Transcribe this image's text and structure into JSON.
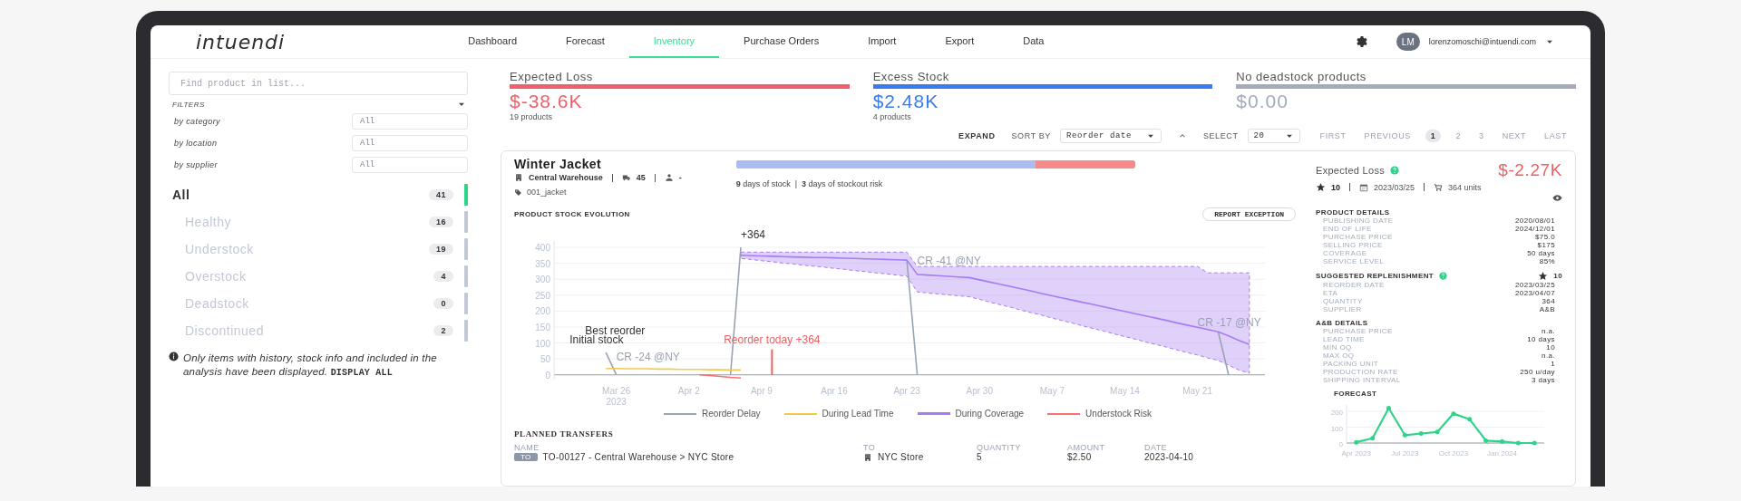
{
  "header": {
    "logo": "intuendi",
    "tabs": [
      {
        "label": "Dashboard",
        "selected": false
      },
      {
        "label": "Forecast",
        "selected": false
      },
      {
        "label": "Inventory",
        "selected": true
      },
      {
        "label": "Purchase Orders",
        "selected": false
      },
      {
        "label": "Import",
        "selected": false
      },
      {
        "label": "Export",
        "selected": false
      },
      {
        "label": "Data",
        "selected": false
      }
    ],
    "user": {
      "initials": "LM",
      "email": "lorenzomoschi@intuendi.com"
    }
  },
  "sidebar": {
    "search": {
      "placeholder": "Find product in list..."
    },
    "filters_label": "FILTERS",
    "filters": [
      {
        "label": "by category",
        "value": "All"
      },
      {
        "label": "by location",
        "value": "All"
      },
      {
        "label": "by supplier",
        "value": "All"
      }
    ],
    "categories": [
      {
        "label": "All",
        "count": "41",
        "selected": true
      },
      {
        "label": "Healthy",
        "count": "16",
        "selected": false
      },
      {
        "label": "Understock",
        "count": "19",
        "selected": false
      },
      {
        "label": "Overstock",
        "count": "4",
        "selected": false
      },
      {
        "label": "Deadstock",
        "count": "0",
        "selected": false
      },
      {
        "label": "Discontinued",
        "count": "2",
        "selected": false
      }
    ],
    "note": {
      "text": "Only items with history, stock info and included in the analysis have been displayed.",
      "link": "DISPLAY ALL"
    }
  },
  "metrics": [
    {
      "title": "Expected Loss",
      "value": "$-38.6K",
      "subtitle": "19 products",
      "color": "#f0606a"
    },
    {
      "title": "Excess Stock",
      "value": "$2.48K",
      "subtitle": "4 products",
      "color": "#3b7bf0"
    },
    {
      "title": "No deadstock products",
      "value": "$0.00",
      "color": "#a3abbd"
    }
  ],
  "toolbar": {
    "expand": "EXPAND",
    "sort_label": "SORT BY",
    "sort_value": "Reorder date",
    "select_label": "SELECT",
    "page_size": "20",
    "pagination": [
      {
        "label": "FIRST",
        "selected": false
      },
      {
        "label": "PREVIOUS",
        "selected": false
      },
      {
        "label": "1",
        "selected": true
      },
      {
        "label": "2",
        "selected": false
      },
      {
        "label": "3",
        "selected": false
      },
      {
        "label": "NEXT",
        "selected": false
      },
      {
        "label": "LAST",
        "selected": false
      }
    ]
  },
  "product": {
    "name": "Winter Jacket",
    "location": "Central Warehouse",
    "stock": "45",
    "supplier": "-",
    "sku": "001_jacket",
    "stock_bar": {
      "level": 0.75
    },
    "stock_text": "**9** days of stock  |  **3** days of stockout risk",
    "expected_loss": {
      "label": "Expected Loss",
      "value": "$-2.27K"
    },
    "priority": "10",
    "reorder_date": "2023/03/25",
    "units": "364 units",
    "stock_evolution": {
      "button": "REPORT EXCEPTION",
      "chart_data": {
        "type": "line",
        "title": "PRODUCT STOCK EVOLUTION",
        "categories": [
          null,
          "Mar 26\n2023",
          null,
          null,
          null,
          null,
          null,
          null,
          "Apr 2",
          null,
          null,
          null,
          null,
          null,
          null,
          "Apr 9",
          null,
          null,
          null,
          null,
          null,
          null,
          "Apr 16",
          null,
          null,
          null,
          null,
          null,
          null,
          "Apr 23",
          null,
          null,
          null,
          null,
          null,
          null,
          "Apr 30",
          null,
          null,
          null,
          null,
          null,
          null,
          "May 7",
          null,
          null,
          null,
          null,
          null,
          null,
          "May 14",
          null,
          null,
          null,
          null,
          null,
          null,
          "May 21",
          null,
          null,
          null,
          null,
          null
        ],
        "ylim": [
          -15,
          420
        ],
        "grid": true,
        "yticks": [
          0,
          50,
          100,
          150,
          200,
          250,
          300,
          350,
          400
        ],
        "series": [
          {
            "name": "Reorder Delay",
            "color": "#9aa3b5",
            "values": [
              70,
              0,
              null,
              null,
              null,
              null,
              null,
              null,
              null,
              null,
              null,
              null,
              0,
              400,
              null,
              null,
              null,
              null,
              null,
              null,
              null,
              null,
              null,
              null,
              null,
              null,
              null,
              null,
              null,
              360,
              0,
              null,
              null,
              null,
              null,
              null,
              null,
              null,
              null,
              null,
              null,
              null,
              null,
              null,
              null,
              null,
              null,
              null,
              null,
              null,
              null,
              null,
              null,
              null,
              null,
              null,
              null,
              null,
              null,
              135,
              0,
              null,
              null
            ]
          },
          {
            "name": "During Lead Time",
            "color": "#f2c94c",
            "values": [
              20,
              20,
              19,
              19,
              19,
              18,
              18,
              17,
              17,
              17,
              16,
              16,
              15,
              15,
              null,
              null,
              null,
              null,
              null,
              null,
              null,
              null,
              null,
              null,
              null,
              null,
              null,
              null,
              null,
              null,
              null,
              null,
              null,
              null,
              null,
              null,
              null,
              null,
              null,
              null,
              null,
              null,
              null,
              null,
              null,
              null,
              null,
              null,
              null,
              null,
              null,
              null,
              null,
              null,
              null,
              null,
              null,
              null,
              null,
              null,
              null,
              null,
              null
            ]
          },
          {
            "name": "During Coverage",
            "color": "#a77bf3",
            "values": [
              null,
              null,
              null,
              null,
              null,
              null,
              null,
              null,
              null,
              null,
              null,
              null,
              null,
              375,
              374,
              373,
              372,
              371,
              370,
              369,
              368,
              368,
              367,
              366,
              365,
              364,
              363,
              362,
              361,
              360,
              315,
              313,
              311,
              309,
              307,
              305,
              298,
              291,
              284,
              277,
              270,
              263,
              255,
              248,
              241,
              234,
              227,
              220,
              213,
              206,
              199,
              192,
              185,
              178,
              171,
              163,
              156,
              149,
              142,
              135,
              122,
              108,
              95
            ],
            "upper": [
              null,
              null,
              null,
              null,
              null,
              null,
              null,
              null,
              null,
              null,
              null,
              null,
              null,
              385,
              385,
              385,
              385,
              385,
              385,
              385,
              385,
              385,
              385,
              385,
              385,
              385,
              385,
              385,
              385,
              385,
              340,
              340,
              340,
              340,
              340,
              340,
              340,
              340,
              340,
              340,
              340,
              340,
              340,
              340,
              340,
              340,
              340,
              340,
              340,
              340,
              340,
              340,
              340,
              340,
              340,
              340,
              340,
              340,
              320,
              320,
              320,
              320,
              320
            ],
            "lower": [
              null,
              null,
              null,
              null,
              null,
              null,
              null,
              null,
              null,
              null,
              null,
              null,
              null,
              365,
              362,
              358,
              355,
              351,
              348,
              344,
              341,
              338,
              334,
              331,
              327,
              324,
              320,
              317,
              313,
              310,
              260,
              257,
              254,
              251,
              248,
              245,
              237,
              228,
              220,
              212,
              203,
              195,
              187,
              178,
              170,
              162,
              153,
              145,
              137,
              128,
              120,
              112,
              103,
              95,
              87,
              78,
              70,
              62,
              53,
              45,
              30,
              15,
              5
            ]
          },
          {
            "name": "Understock Risk",
            "color": "#f87171",
            "values": [
              null,
              null,
              null,
              null,
              null,
              null,
              null,
              null,
              null,
              0,
              -2,
              -5,
              -8,
              -10,
              null,
              null,
              null,
              null,
              null,
              null,
              null,
              null,
              null,
              null,
              null,
              null,
              null,
              null,
              null,
              null,
              null,
              null,
              null,
              null,
              null,
              null,
              null,
              null,
              null,
              null,
              null,
              null,
              null,
              null,
              null,
              null,
              null,
              null,
              null,
              null,
              null,
              null,
              null,
              null,
              null,
              null,
              null,
              null,
              null,
              null,
              null,
              null,
              null
            ]
          }
        ],
        "annotations": [
          "+364",
          "Best reorder",
          "Initial stock",
          "CR -24 @NY",
          "Reorder today +364",
          "CR -41 @NY",
          "CR -17 @NY"
        ]
      }
    },
    "details": [
      {
        "title": "PRODUCT DETAILS",
        "rows": [
          {
            "label": "PUBLISHING DATE",
            "value": "2020/08/01"
          },
          {
            "label": "END OF LIFE",
            "value": "2024/12/01"
          },
          {
            "label": "PURCHASE PRICE",
            "value": "$75.0"
          },
          {
            "label": "SELLING PRICE",
            "value": "$175"
          },
          {
            "label": "COVERAGE",
            "value": "50 days"
          },
          {
            "label": "SERVICE LEVEL",
            "value": "85%"
          }
        ]
      },
      {
        "title": "SUGGESTED REPLENISHMENT",
        "priority": "10",
        "rows": [
          {
            "label": "REORDER DATE",
            "value": "2023/03/25"
          },
          {
            "label": "ETA",
            "value": "2023/04/07"
          },
          {
            "label": "QUANTITY",
            "value": "364"
          },
          {
            "label": "SUPPLIER",
            "value": "A&B"
          }
        ]
      },
      {
        "title": "A&B DETAILS",
        "rows": [
          {
            "label": "PURCHASE PRICE",
            "value": "n.a."
          },
          {
            "label": "LEAD TIME",
            "value": "10 days"
          },
          {
            "label": "MIN OQ",
            "value": "10"
          },
          {
            "label": "MAX OQ",
            "value": "n.a."
          },
          {
            "label": "PACKING UNIT",
            "value": "1"
          },
          {
            "label": "PRODUCTION RATE",
            "value": "250 u/day"
          },
          {
            "label": "SHIPPING INTERVAL",
            "value": "3 days"
          }
        ]
      }
    ],
    "forecast": {
      "chart_data": {
        "type": "line",
        "title": "FORECAST",
        "categories": [
          "Apr 2023",
          null,
          null,
          "Jul 2023",
          null,
          null,
          "Oct 2023",
          null,
          null,
          "Jan 2024",
          null,
          null
        ],
        "ylim": [
          0,
          240
        ],
        "grid": true,
        "yticks": [
          0,
          100,
          200
        ],
        "series": [
          {
            "color": "#2fd38a",
            "values": [
              5,
              30,
              220,
              50,
              60,
              70,
              185,
              150,
              15,
              10,
              0,
              0
            ]
          }
        ]
      }
    },
    "transfers": {
      "title": "PLANNED TRANSFERS",
      "columns": [
        "NAME",
        "TO",
        "QUANTITY",
        "AMOUNT",
        "DATE"
      ],
      "rows": [
        {
          "type": "TO",
          "name": "TO-00127 - Central Warehouse > NYC Store",
          "to": "NYC Store",
          "quantity": "5",
          "amount": "$2.50",
          "date": "2023-04-10"
        }
      ]
    }
  }
}
